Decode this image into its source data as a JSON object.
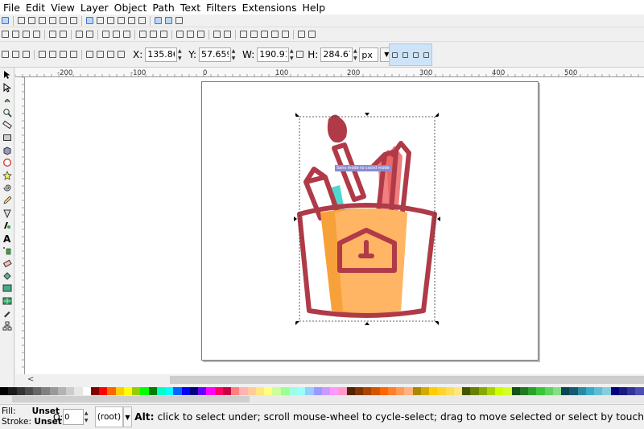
{
  "menu": [
    "File",
    "Edit",
    "View",
    "Layer",
    "Object",
    "Path",
    "Text",
    "Filters",
    "Extensions",
    "Help"
  ],
  "toolbar_fields": [
    {
      "label": "X:",
      "value": "135.862"
    },
    {
      "label": "Y:",
      "value": "57.659"
    },
    {
      "label": "W:",
      "value": "190.919"
    },
    {
      "label": "H:",
      "value": "284.677"
    }
  ],
  "units": "px",
  "ruler_labels": [
    "-200",
    "-100",
    "0",
    "100",
    "200",
    "300",
    "400",
    "500"
  ],
  "tooltip": "Sans mode to coord mode",
  "status": {
    "fill_label": "Fill:",
    "fill_value": "Unset",
    "stroke_label": "Stroke:",
    "stroke_value": "Unset",
    "opacity_label": "O:",
    "opacity_value": "0",
    "layer": "(root)",
    "message_key": "Alt:",
    "message": " click to select under; scroll mouse-wheel to cycle-select; drag to move selected or select by touch"
  },
  "palette": [
    "#000000",
    "#1a1a1a",
    "#333333",
    "#4d4d4d",
    "#666666",
    "#808080",
    "#999999",
    "#b3b3b3",
    "#cccccc",
    "#e6e6e6",
    "#ffffff",
    "#800000",
    "#ff0000",
    "#ff6600",
    "#ffcc00",
    "#ffff00",
    "#99cc00",
    "#00ff00",
    "#008000",
    "#00ffcc",
    "#00ffff",
    "#0066ff",
    "#0000ff",
    "#000080",
    "#6600ff",
    "#ff00ff",
    "#ff0066",
    "#cc0044",
    "#ff8080",
    "#ffb3b3",
    "#ffcc99",
    "#ffe680",
    "#ffff80",
    "#ccff99",
    "#99ff99",
    "#99ffe6",
    "#99ffff",
    "#99ccff",
    "#9999ff",
    "#cc99ff",
    "#ff99ff",
    "#ff99cc",
    "#552200",
    "#803300",
    "#aa4400",
    "#d45500",
    "#ff6600",
    "#ff7f2a",
    "#ff9955",
    "#ffb380",
    "#aa8800",
    "#d4aa00",
    "#ffcc00",
    "#ffd42a",
    "#ffdd55",
    "#ffe680",
    "#445500",
    "#668000",
    "#88aa00",
    "#aad400",
    "#ccff00",
    "#d4ff2a",
    "#165016",
    "#217821",
    "#2ca02c",
    "#37c837",
    "#5fd35f",
    "#87de87",
    "#0b4455",
    "#165a72",
    "#2c89a0",
    "#37abc8",
    "#5fbcd3",
    "#87cdde",
    "#000080",
    "#1a1a80",
    "#333399",
    "#4d4db3"
  ],
  "colors": {
    "pot_outline": "#b03a48",
    "pot_fill": "#ffb563",
    "pot_shade": "#f7a13a",
    "pencil_red": "#e8605f",
    "pencil_pink": "#f08080",
    "teal": "#4fd8d0",
    "selection": "#3876c6"
  }
}
